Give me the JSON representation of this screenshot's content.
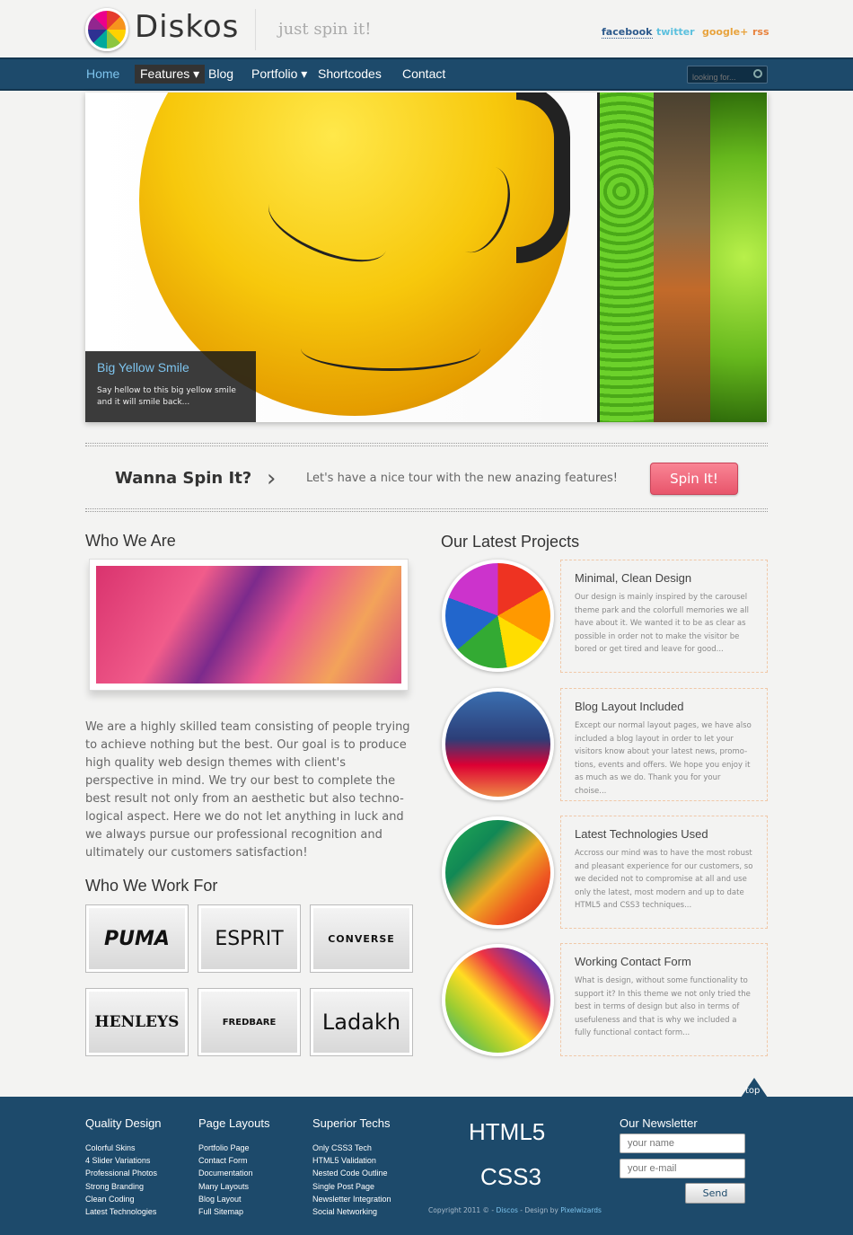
{
  "header": {
    "logo": "Diskos",
    "tagline": "just spin it!",
    "social": [
      "facebook",
      "twitter",
      "google+",
      "rss"
    ]
  },
  "nav": {
    "items": [
      "Home",
      "Features",
      "Blog",
      "Portfolio",
      "Shortcodes",
      "Contact"
    ],
    "search_placeholder": "looking for..."
  },
  "slider": {
    "caption_title": "Big Yellow Smile",
    "caption_text": "Say hellow to this big yellow smile and it will smile back..."
  },
  "cta": {
    "title": "Wanna Spin It?",
    "text": "Let's have a nice tour with the new anazing features!",
    "button": "Spin It!"
  },
  "about": {
    "heading": "Who We Are",
    "text": "We are a highly skilled team consisting of people trying to achieve nothing but the best. Our goal is to produce high quality web design themes with client's perspective in mind. We try our best to complete the best result not only from an aesthetic but also techno-logical aspect. Here we do not let anything in luck and we always pursue our professional recognition and ultimately our customers satisfaction!"
  },
  "clients": {
    "heading": "Who We Work For",
    "brands": [
      "PUMA",
      "ESPRIT",
      "CONVERSE",
      "HENLEYS",
      "FREDBARE",
      "Ladakh"
    ]
  },
  "projects": {
    "heading": "Our Latest Projects",
    "items": [
      {
        "title": "Minimal, Clean Design",
        "desc": "Our design is mainly inspired by the carousel theme park and the colorfull memories we all have about it. We wanted it to be as clear as possible in order not to make the visitor be bored or get tired and leave for good..."
      },
      {
        "title": "Blog Layout Included",
        "desc": "Except our normal layout pages, we have also included a blog layout in order to let your visitors know about your latest news, promo-tions, events and offers. We hope you enjoy it as much as we do. Thank you for your choise..."
      },
      {
        "title": "Latest Technologies Used",
        "desc": "Accross our mind was to have the most robust and pleasant experience for our customers, so we decided not to compromise at all and use only the latest, most modern and up to date HTML5 and CSS3 techniques..."
      },
      {
        "title": "Working Contact Form",
        "desc": "What is design, without some functionality to support it? In this theme we not only tried the best in terms of design but also in terms of usefuleness and that is why we included a fully functional contact form..."
      }
    ]
  },
  "footer": {
    "top": "top",
    "cols": [
      {
        "heading": "Quality Design",
        "items": [
          "Colorful Skins",
          "4 Slider Variations",
          "Professional Photos",
          "Strong Branding",
          "Clean Coding",
          "Latest Technologies"
        ]
      },
      {
        "heading": "Page Layouts",
        "items": [
          "Portfolio Page",
          "Contact Form",
          "Documentation",
          "Many Layouts",
          "Blog Layout",
          "Full Sitemap"
        ]
      },
      {
        "heading": "Superior Techs",
        "items": [
          "Only CSS3 Tech",
          "HTML5 Validation",
          "Nested Code Outline",
          "Single Post Page",
          "Newsletter Integration",
          "Social Networking"
        ]
      }
    ],
    "html5": "HTML5",
    "css3": "CSS3",
    "copyright": "Copyright 2011 © -",
    "copyright_link1": "Discos",
    "copyright_mid": "- Design by",
    "copyright_link2": "Pixelwizards",
    "newsletter": {
      "heading": "Our Newsletter",
      "name_placeholder": "your name",
      "email_placeholder": "your e-mail",
      "button": "Send"
    }
  }
}
